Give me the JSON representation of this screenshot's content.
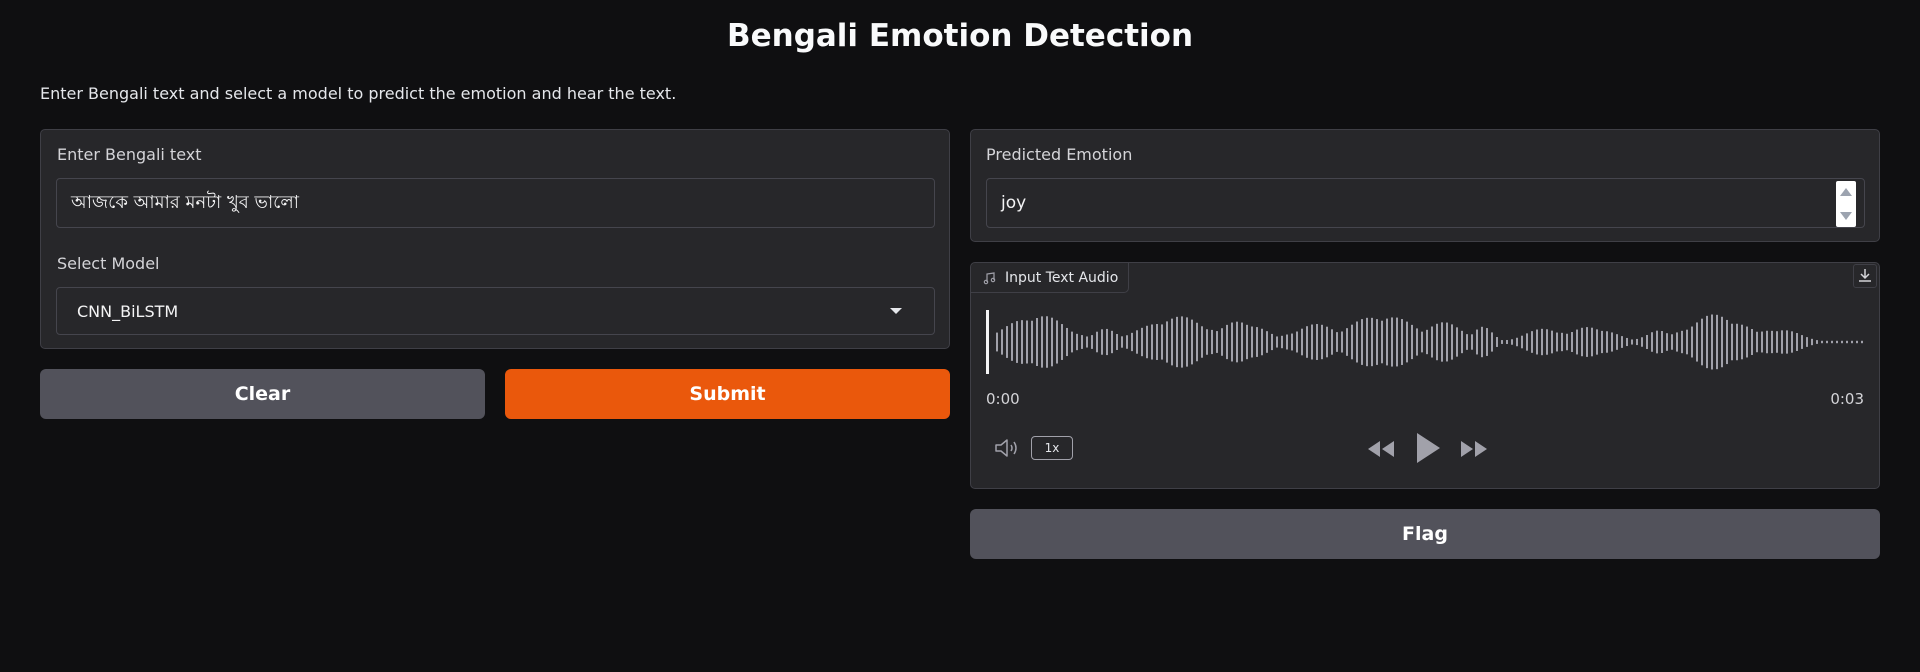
{
  "header": {
    "title": "Bengali Emotion Detection",
    "description": "Enter Bengali text and select a model to predict the emotion and hear the text."
  },
  "input_panel": {
    "text_label": "Enter Bengali text",
    "text_value": "আজকে আমার মনটা খুব ভালো",
    "model_label": "Select Model",
    "model_value": "CNN_BiLSTM"
  },
  "actions": {
    "clear_label": "Clear",
    "submit_label": "Submit",
    "flag_label": "Flag"
  },
  "output_panel": {
    "emotion_label": "Predicted Emotion",
    "emotion_value": "joy"
  },
  "audio": {
    "label": "Input Text Audio",
    "current_time": "0:00",
    "duration": "0:03",
    "playback_rate": "1x",
    "progress": 0,
    "icons": {
      "music": "music-note-icon",
      "download": "download-icon",
      "volume": "volume-icon",
      "rewind": "rewind-icon",
      "play": "play-icon",
      "forward": "fast-forward-icon"
    }
  },
  "colors": {
    "background": "#0f0f11",
    "panel": "#27272a",
    "primary": "#ea580c",
    "secondary": "#52525b"
  }
}
